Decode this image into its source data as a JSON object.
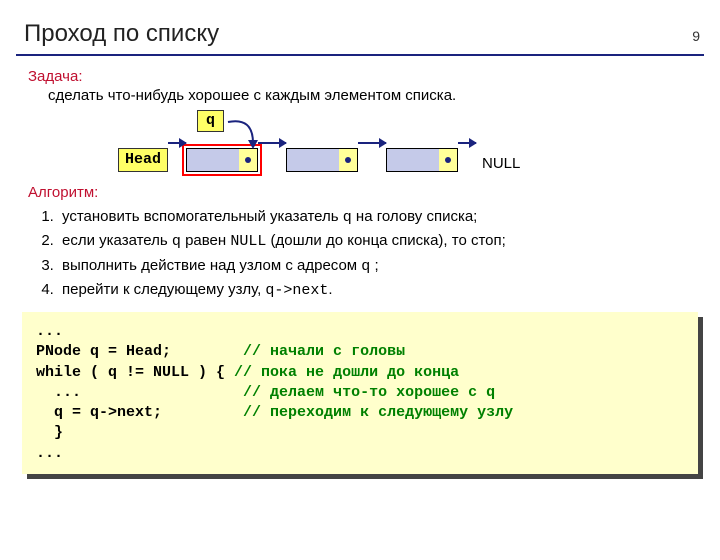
{
  "page_number": "9",
  "title": "Проход по списку",
  "task_label": "Задача:",
  "task_text": "сделать что-нибудь хорошее с каждым элементом списка.",
  "diagram": {
    "q_label": "q",
    "head_label": "Head",
    "null_label": "NULL"
  },
  "algorithm_label": "Алгоритм:",
  "steps": {
    "s1a": "установить вспомогательный указатель ",
    "s1b": "q",
    "s1c": " на голову списка;",
    "s2a": "если указатель ",
    "s2b": "q",
    "s2c": "  равен ",
    "s2d": "NULL",
    "s2e": " (дошли до конца списка), то стоп;",
    "s3a": "выполнить действие над узлом с адресом ",
    "s3b": "q",
    "s3c": " ;",
    "s4a": "перейти к следующему узлу, ",
    "s4b": "q->next",
    "s4c": "."
  },
  "code": {
    "l1": "...",
    "l2a": "PNode q = Head;",
    "l2b": "// начали с головы",
    "l3a": "while ( q != NULL ) {",
    "l3b": "// пока не дошли до конца",
    "l4a": "  ...",
    "l4b": "// делаем что-то хорошее с q",
    "l5a": "  q = q->next;",
    "l5b": "// переходим к следующему узлу",
    "l6": "  }",
    "l7": "..."
  }
}
